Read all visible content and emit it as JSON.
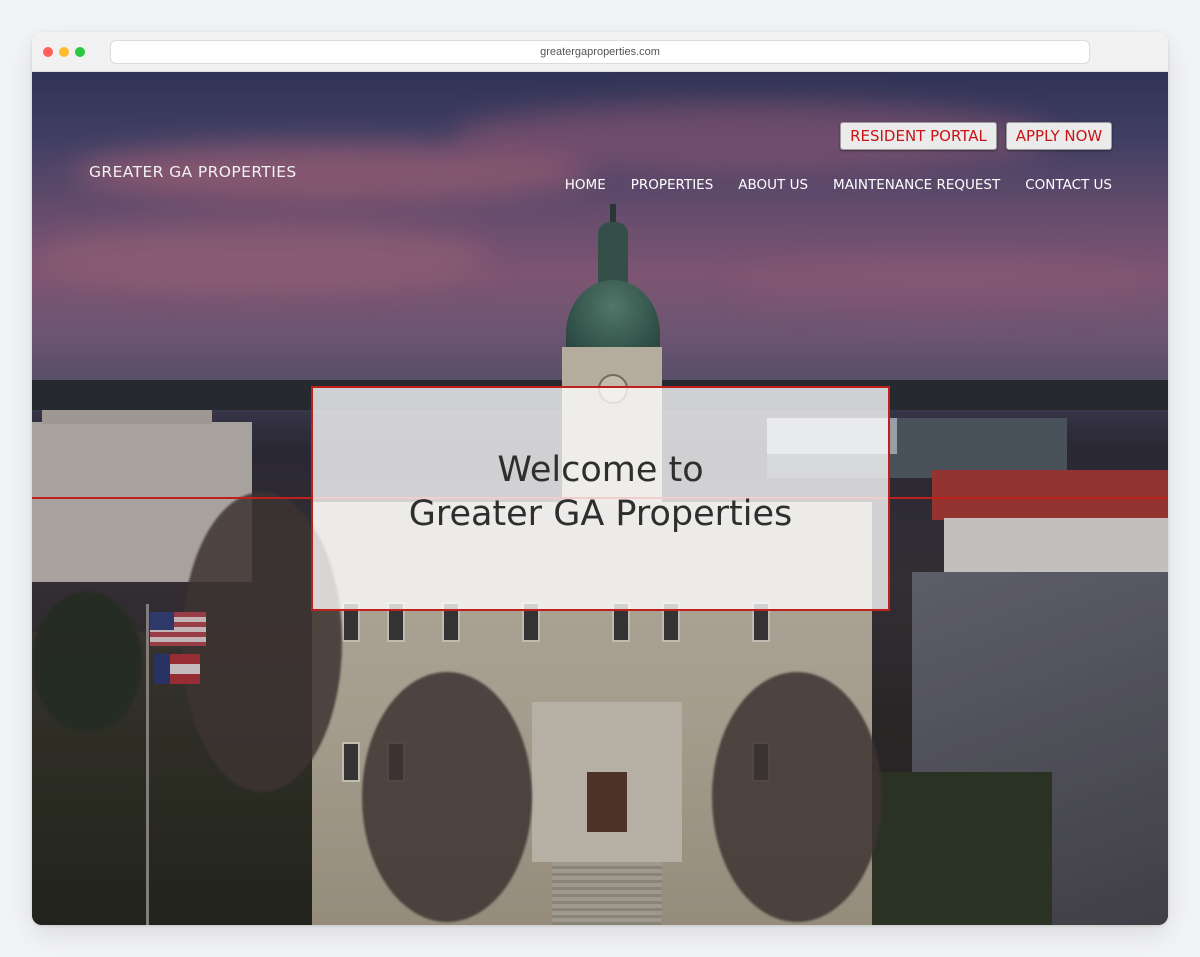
{
  "browser": {
    "url": "greatergaproperties.com"
  },
  "header": {
    "brand": "GREATER GA PROPERTIES",
    "cta": {
      "resident_portal": "RESIDENT PORTAL",
      "apply_now": "APPLY NOW"
    },
    "nav": [
      "HOME",
      "PROPERTIES",
      "ABOUT US",
      "MAINTENANCE REQUEST",
      "CONTACT US"
    ]
  },
  "hero": {
    "title_line1": "Welcome to",
    "title_line2": "Greater GA Properties"
  },
  "colors": {
    "accent": "#c81414",
    "frame_red": "#c0201c"
  }
}
